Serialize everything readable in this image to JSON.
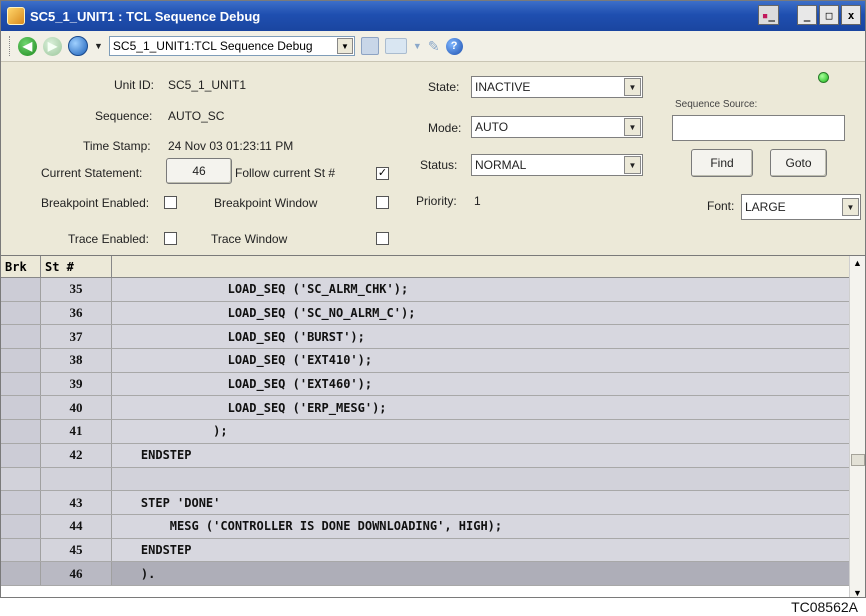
{
  "window": {
    "title": "SC5_1_UNIT1 : TCL Sequence Debug",
    "controls": {
      "restore_pair": "_",
      "minimize": "_",
      "maximize": "□",
      "close": "x"
    }
  },
  "toolbar": {
    "address_value": "SC5_1_UNIT1:TCL Sequence Debug"
  },
  "form": {
    "unit_id_label": "Unit ID:",
    "unit_id_value": "SC5_1_UNIT1",
    "sequence_label": "Sequence:",
    "sequence_value": "AUTO_SC",
    "time_stamp_label": "Time Stamp:",
    "time_stamp_value": "24 Nov 03 01:23:11 PM",
    "current_statement_label": "Current Statement:",
    "current_statement_value": "46",
    "follow_label": "Follow current St #",
    "follow_checked": "✓",
    "breakpoint_enabled_label": "Breakpoint Enabled:",
    "breakpoint_window_label": "Breakpoint Window",
    "trace_enabled_label": "Trace Enabled:",
    "trace_window_label": "Trace Window",
    "state_label": "State:",
    "state_value": "INACTIVE",
    "mode_label": "Mode:",
    "mode_value": "AUTO",
    "status_label": "Status:",
    "status_value": "NORMAL",
    "priority_label": "Priority:",
    "priority_value": "1",
    "sequence_source_label": "Sequence Source:",
    "find_label": "Find",
    "goto_label": "Goto",
    "font_label": "Font:",
    "font_value": "LARGE",
    "status_led_color": "#18b818"
  },
  "grid": {
    "headers": {
      "brk": "Brk",
      "st": "St #",
      "code": ""
    },
    "rows": [
      {
        "st": "35",
        "code": "                LOAD_SEQ ('SC_ALRM_CHK');"
      },
      {
        "st": "36",
        "code": "                LOAD_SEQ ('SC_NO_ALRM_C');"
      },
      {
        "st": "37",
        "code": "                LOAD_SEQ ('BURST');"
      },
      {
        "st": "38",
        "code": "                LOAD_SEQ ('EXT410');"
      },
      {
        "st": "39",
        "code": "                LOAD_SEQ ('EXT460');"
      },
      {
        "st": "40",
        "code": "                LOAD_SEQ ('ERP_MESG');"
      },
      {
        "st": "41",
        "code": "              );"
      },
      {
        "st": "42",
        "code": "    ENDSTEP"
      },
      {
        "st": "",
        "code": ""
      },
      {
        "st": "43",
        "code": "    STEP 'DONE'"
      },
      {
        "st": "44",
        "code": "        MESG ('CONTROLLER IS DONE DOWNLOADING', HIGH);"
      },
      {
        "st": "45",
        "code": "    ENDSTEP"
      },
      {
        "st": "46",
        "code": "    )."
      }
    ],
    "current_row_st": "46"
  },
  "caption": "TC08562A"
}
